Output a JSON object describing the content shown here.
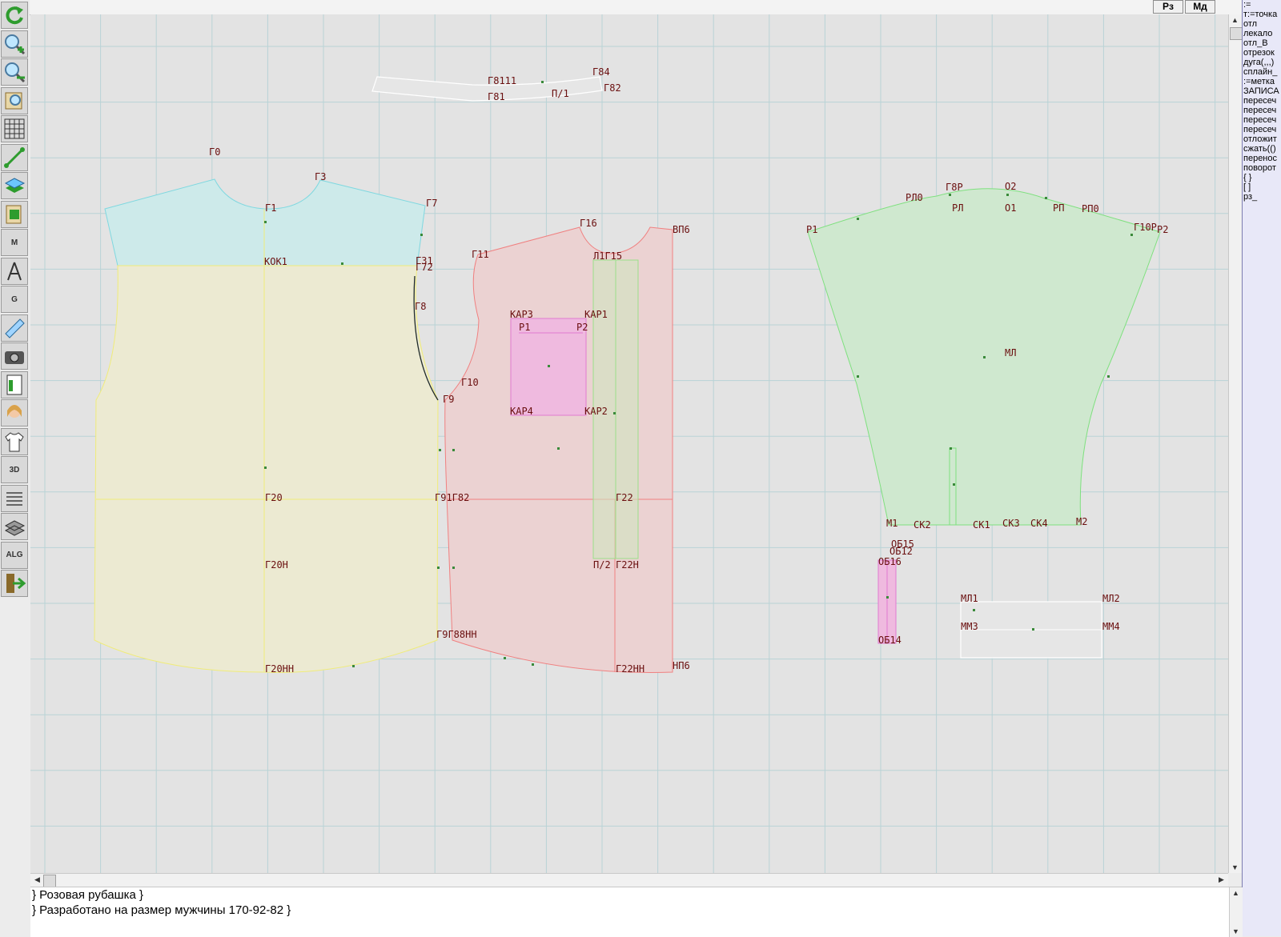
{
  "app": {
    "top_buttons": [
      "Рз",
      "Мд"
    ]
  },
  "toolbar": {
    "tools": [
      {
        "name": "refresh-icon",
        "glyph": ""
      },
      {
        "name": "zoom-in-icon",
        "glyph": ""
      },
      {
        "name": "zoom-out-icon",
        "glyph": ""
      },
      {
        "name": "zoom-fit-icon",
        "glyph": ""
      },
      {
        "name": "grid-icon",
        "glyph": ""
      },
      {
        "name": "line-segment-icon",
        "glyph": ""
      },
      {
        "name": "layers-icon",
        "glyph": ""
      },
      {
        "name": "pattern-book-icon",
        "glyph": ""
      },
      {
        "name": "measure-m-icon",
        "glyph": "M"
      },
      {
        "name": "compass-icon",
        "glyph": ""
      },
      {
        "name": "curve-g-icon",
        "glyph": "G"
      },
      {
        "name": "ruler-icon",
        "glyph": ""
      },
      {
        "name": "camera-icon",
        "glyph": ""
      },
      {
        "name": "table-icon",
        "glyph": ""
      },
      {
        "name": "model-portrait-icon",
        "glyph": ""
      },
      {
        "name": "shirt-icon",
        "glyph": ""
      },
      {
        "name": "3d-view-icon",
        "glyph": "3D"
      },
      {
        "name": "document-icon",
        "glyph": ""
      },
      {
        "name": "stack-icon",
        "glyph": ""
      },
      {
        "name": "algorithm-icon",
        "glyph": "ALG"
      },
      {
        "name": "exit-icon",
        "glyph": ""
      }
    ]
  },
  "command_panel": {
    "items": [
      ":=",
      "т:=точка",
      "отл",
      "лекало",
      "отл_В",
      "отрезок",
      "дуга(,,,)",
      "сплайн_",
      ":=метка",
      "ЗАПИСА",
      "пересеч",
      "пересеч",
      "пересеч",
      "пересеч",
      "отложит",
      "сжать(()",
      "перенос",
      "поворот",
      "{ }",
      "[ ]",
      "рз_"
    ]
  },
  "info": {
    "line1": "}   Розовая рубашка  }",
    "line2": "} Разработано на размер мужчины 170-92-82 }"
  },
  "colors": {
    "canvas": "#e3e3e3",
    "grid": "#b9d3d6",
    "yoke": "#cdeaea",
    "back": "#ecead2",
    "front": "#ebd2d2",
    "sleeve": "#cfe8cf",
    "pocket": "#efbadf",
    "label": "#6a0f0f"
  },
  "labels": {
    "collar": [
      "Г8111",
      "Г84",
      "Г82",
      "Г81",
      "П/1"
    ],
    "yoke": [
      "Г0",
      "Г3",
      "Г1",
      "Г7",
      "КОК1",
      "Г31",
      "Г72"
    ],
    "back": [
      "Г8",
      "Г9",
      "Г20",
      "Г20Н",
      "Г20НН",
      "Г91Г82",
      "Г9Г88НН"
    ],
    "front": [
      "Г16",
      "ВП6",
      "Г11",
      "Л1Г15",
      "КАР3",
      "КАР1",
      "Р1",
      "Р2",
      "КАР4",
      "КАР2",
      "Г10",
      "Г22",
      "П/2",
      "Г22Н",
      "Г22НН",
      "НП6"
    ],
    "sleeve": [
      "Г8Р",
      "О2",
      "РЛ0",
      "РЛ",
      "О1",
      "РП",
      "РП0",
      "Р1",
      "Г10Р",
      "Р2",
      "МЛ",
      "М1",
      "СК2",
      "СК1",
      "СК3",
      "СК4",
      "М2"
    ],
    "cuff": [
      "МЛ1",
      "МЛ2",
      "ММ3",
      "ММ4"
    ],
    "placket": [
      "ОБ15",
      "ОБ12",
      "ОБ16",
      "ОБ14"
    ]
  }
}
